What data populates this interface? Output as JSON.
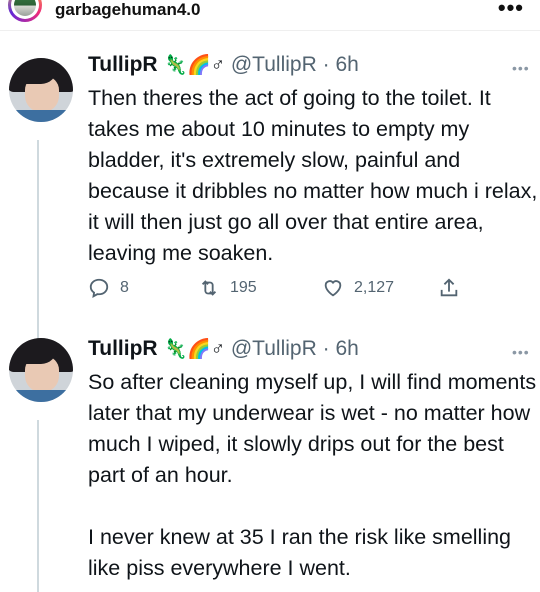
{
  "header": {
    "username": "garbagehuman4.0",
    "more": "•••"
  },
  "tweets": [
    {
      "name": "TullipR",
      "emojis": "🦎🌈♂",
      "handle": "@TullipR",
      "sep": "·",
      "time": "6h",
      "text": "Then theres the act of going to the toilet. It takes me about 10 minutes to empty my bladder, it's extremely slow, painful and because it dribbles no matter how much i relax, it will then just go all over that entire area, leaving me soaken.",
      "actions": {
        "replies": "8",
        "retweets": "195",
        "likes": "2,127"
      }
    },
    {
      "name": "TullipR",
      "emojis": "🦎🌈♂",
      "handle": "@TullipR",
      "sep": "·",
      "time": "6h",
      "text": "So after cleaning myself up, I will find moments later that my underwear is wet - no matter how much I wiped, it slowly drips out for the best part of an hour.\n\nI never knew at 35 I ran the risk like smelling like piss everywhere I went."
    }
  ],
  "colors": {
    "text": "#0f1419",
    "muted": "#536471",
    "line": "#cfd9de"
  }
}
